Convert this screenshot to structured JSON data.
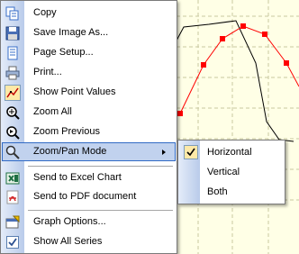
{
  "menu": {
    "items": [
      {
        "label": "Copy",
        "icon": "copy-icon"
      },
      {
        "label": "Save Image As...",
        "icon": "floppy-disk-icon"
      },
      {
        "label": "Page Setup...",
        "icon": "page-setup-icon"
      },
      {
        "label": "Print...",
        "icon": "printer-icon"
      },
      {
        "label": "Show Point Values",
        "icon": "point-values-icon"
      },
      {
        "label": "Zoom All",
        "icon": "zoom-all-icon"
      },
      {
        "label": "Zoom Previous",
        "icon": "zoom-previous-icon"
      },
      {
        "label": "Zoom/Pan Mode",
        "icon": "magnifier-icon",
        "highlighted": true,
        "has_submenu": true
      },
      {
        "label": "Send to Excel Chart",
        "icon": "excel-icon"
      },
      {
        "label": "Send to PDF document",
        "icon": "pdf-icon"
      },
      {
        "label": "Graph Options...",
        "icon": "graph-options-icon"
      },
      {
        "label": "Show All Series",
        "icon": "checkbox-checked-icon"
      }
    ]
  },
  "submenu": {
    "items": [
      {
        "label": "Horizontal",
        "checked": true
      },
      {
        "label": "Vertical",
        "checked": false
      },
      {
        "label": "Both",
        "checked": false
      }
    ]
  },
  "colors": {
    "grid_background": "#ffffe6",
    "grid_line": "#c8c8a0",
    "series_red": "#ff0000",
    "series_black": "#000000",
    "menu_highlight": "#c1d2ee",
    "menu_highlight_border": "#316ac5"
  }
}
